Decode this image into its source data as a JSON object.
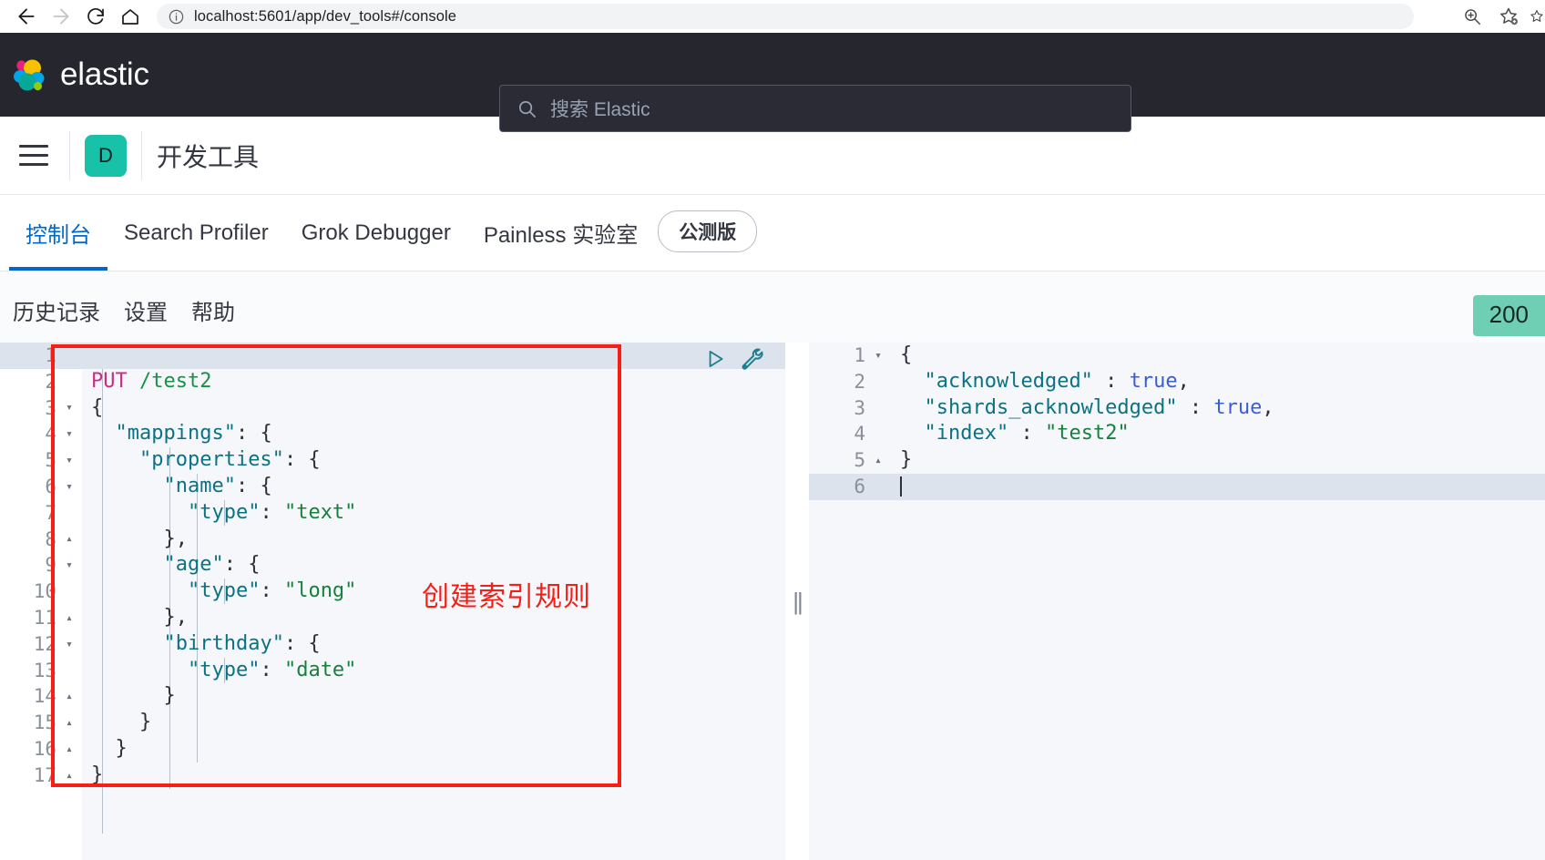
{
  "browser": {
    "url": "localhost:5601/app/dev_tools#/console",
    "back_label": "Back",
    "forward_label": "Forward",
    "reload_label": "Reload",
    "home_label": "Home",
    "zoom_label": "Zoom",
    "bookmark_label": "Add bookmark",
    "collections_label": "Collections"
  },
  "elastic_header": {
    "brand": "elastic",
    "search_placeholder": "搜索 Elastic"
  },
  "app_header": {
    "menu_label": "菜单",
    "space_initial": "D",
    "title": "开发工具"
  },
  "tabs": [
    {
      "label": "控制台",
      "active": true
    },
    {
      "label": "Search Profiler",
      "active": false
    },
    {
      "label": "Grok Debugger",
      "active": false
    },
    {
      "label": "Painless 实验室",
      "active": false
    }
  ],
  "beta_badge": "公测版",
  "console_toolbar": {
    "items": [
      "历史记录",
      "设置",
      "帮助"
    ],
    "status_code": "200",
    "status_color": "#6ecfb4"
  },
  "annotation": {
    "text": "创建索引规则",
    "color": "#f71e16"
  },
  "request_editor": {
    "play_icon": "play-icon",
    "wrench_icon": "wrench-icon",
    "lines": [
      {
        "n": "1",
        "fold": "",
        "tokens": [],
        "current": true
      },
      {
        "n": "2",
        "fold": "",
        "tokens": [
          {
            "t": "method",
            "v": "PUT"
          },
          {
            "t": "plain",
            "v": " "
          },
          {
            "t": "url",
            "v": "/test2"
          }
        ]
      },
      {
        "n": "3",
        "fold": "▾",
        "tokens": [
          {
            "t": "punct",
            "v": "{"
          }
        ]
      },
      {
        "n": "4",
        "fold": "▾",
        "tokens": [
          {
            "t": "plain",
            "v": "  "
          },
          {
            "t": "key",
            "v": "\"mappings\""
          },
          {
            "t": "punct",
            "v": ": {"
          }
        ]
      },
      {
        "n": "5",
        "fold": "▾",
        "tokens": [
          {
            "t": "plain",
            "v": "    "
          },
          {
            "t": "key",
            "v": "\"properties\""
          },
          {
            "t": "punct",
            "v": ": {"
          }
        ]
      },
      {
        "n": "6",
        "fold": "▾",
        "tokens": [
          {
            "t": "plain",
            "v": "      "
          },
          {
            "t": "key",
            "v": "\"name\""
          },
          {
            "t": "punct",
            "v": ": {"
          }
        ]
      },
      {
        "n": "7",
        "fold": "",
        "tokens": [
          {
            "t": "plain",
            "v": "        "
          },
          {
            "t": "key",
            "v": "\"type\""
          },
          {
            "t": "punct",
            "v": ": "
          },
          {
            "t": "str",
            "v": "\"text\""
          }
        ]
      },
      {
        "n": "8",
        "fold": "▴",
        "tokens": [
          {
            "t": "plain",
            "v": "      "
          },
          {
            "t": "punct",
            "v": "},"
          }
        ]
      },
      {
        "n": "9",
        "fold": "▾",
        "tokens": [
          {
            "t": "plain",
            "v": "      "
          },
          {
            "t": "key",
            "v": "\"age\""
          },
          {
            "t": "punct",
            "v": ": {"
          }
        ]
      },
      {
        "n": "10",
        "fold": "",
        "tokens": [
          {
            "t": "plain",
            "v": "        "
          },
          {
            "t": "key",
            "v": "\"type\""
          },
          {
            "t": "punct",
            "v": ": "
          },
          {
            "t": "str",
            "v": "\"long\""
          }
        ]
      },
      {
        "n": "11",
        "fold": "▴",
        "tokens": [
          {
            "t": "plain",
            "v": "      "
          },
          {
            "t": "punct",
            "v": "},"
          }
        ]
      },
      {
        "n": "12",
        "fold": "▾",
        "tokens": [
          {
            "t": "plain",
            "v": "      "
          },
          {
            "t": "key",
            "v": "\"birthday\""
          },
          {
            "t": "punct",
            "v": ": {"
          }
        ]
      },
      {
        "n": "13",
        "fold": "",
        "tokens": [
          {
            "t": "plain",
            "v": "        "
          },
          {
            "t": "key",
            "v": "\"type\""
          },
          {
            "t": "punct",
            "v": ": "
          },
          {
            "t": "str",
            "v": "\"date\""
          }
        ]
      },
      {
        "n": "14",
        "fold": "▴",
        "tokens": [
          {
            "t": "plain",
            "v": "      "
          },
          {
            "t": "punct",
            "v": "}"
          }
        ]
      },
      {
        "n": "15",
        "fold": "▴",
        "tokens": [
          {
            "t": "plain",
            "v": "    "
          },
          {
            "t": "punct",
            "v": "}"
          }
        ]
      },
      {
        "n": "16",
        "fold": "▴",
        "tokens": [
          {
            "t": "plain",
            "v": "  "
          },
          {
            "t": "punct",
            "v": "}"
          }
        ]
      },
      {
        "n": "17",
        "fold": "▴",
        "tokens": [
          {
            "t": "punct",
            "v": "}"
          }
        ]
      }
    ]
  },
  "response_editor": {
    "lines": [
      {
        "n": "1",
        "fold": "▾",
        "tokens": [
          {
            "t": "punct",
            "v": "{"
          }
        ]
      },
      {
        "n": "2",
        "fold": "",
        "tokens": [
          {
            "t": "plain",
            "v": "  "
          },
          {
            "t": "key",
            "v": "\"acknowledged\""
          },
          {
            "t": "punct",
            "v": " : "
          },
          {
            "t": "bool",
            "v": "true"
          },
          {
            "t": "punct",
            "v": ","
          }
        ]
      },
      {
        "n": "3",
        "fold": "",
        "tokens": [
          {
            "t": "plain",
            "v": "  "
          },
          {
            "t": "key",
            "v": "\"shards_acknowledged\""
          },
          {
            "t": "punct",
            "v": " : "
          },
          {
            "t": "bool",
            "v": "true"
          },
          {
            "t": "punct",
            "v": ","
          }
        ]
      },
      {
        "n": "4",
        "fold": "",
        "tokens": [
          {
            "t": "plain",
            "v": "  "
          },
          {
            "t": "key",
            "v": "\"index\""
          },
          {
            "t": "punct",
            "v": " : "
          },
          {
            "t": "str",
            "v": "\"test2\""
          }
        ]
      },
      {
        "n": "5",
        "fold": "▴",
        "tokens": [
          {
            "t": "punct",
            "v": "}"
          }
        ]
      },
      {
        "n": "6",
        "fold": "",
        "tokens": [],
        "current": true
      }
    ]
  }
}
